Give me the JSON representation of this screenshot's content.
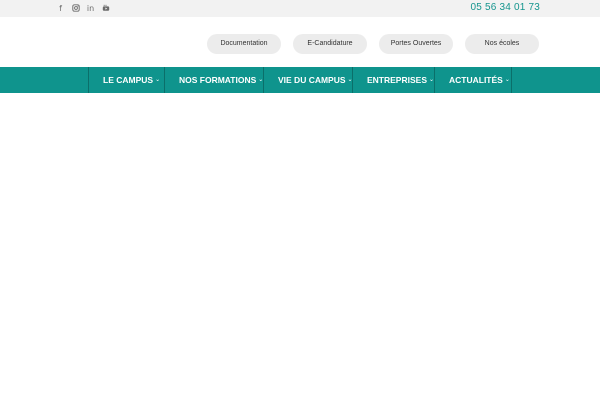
{
  "topbar": {
    "social": [
      {
        "icon": "facebook-icon",
        "glyph": "f"
      },
      {
        "icon": "instagram-icon",
        "glyph": ""
      },
      {
        "icon": "linkedin-icon",
        "glyph": "in"
      },
      {
        "icon": "youtube-icon",
        "glyph": ""
      }
    ],
    "phone": "05 56 34 01 73"
  },
  "header": {
    "buttons": [
      {
        "label": "Documentation"
      },
      {
        "label": "E-Candidature"
      },
      {
        "label": "Portes Ouvertes"
      },
      {
        "label": "Nos écoles"
      }
    ]
  },
  "nav": {
    "items": [
      {
        "label": "LE CAMPUS",
        "chevron": "⌄"
      },
      {
        "label": "NOS FORMATIONS",
        "chevron": "⌄"
      },
      {
        "label": "VIE DU CAMPUS",
        "chevron": "⌄"
      },
      {
        "label": "ENTREPRISES",
        "chevron": "⌄"
      },
      {
        "label": "ACTUALITÉS",
        "chevron": "⌄"
      }
    ]
  },
  "colors": {
    "accent": "#0f948d",
    "phone": "#15958e",
    "topbar_bg": "#f2f2f2",
    "pill_bg": "#ececec"
  }
}
